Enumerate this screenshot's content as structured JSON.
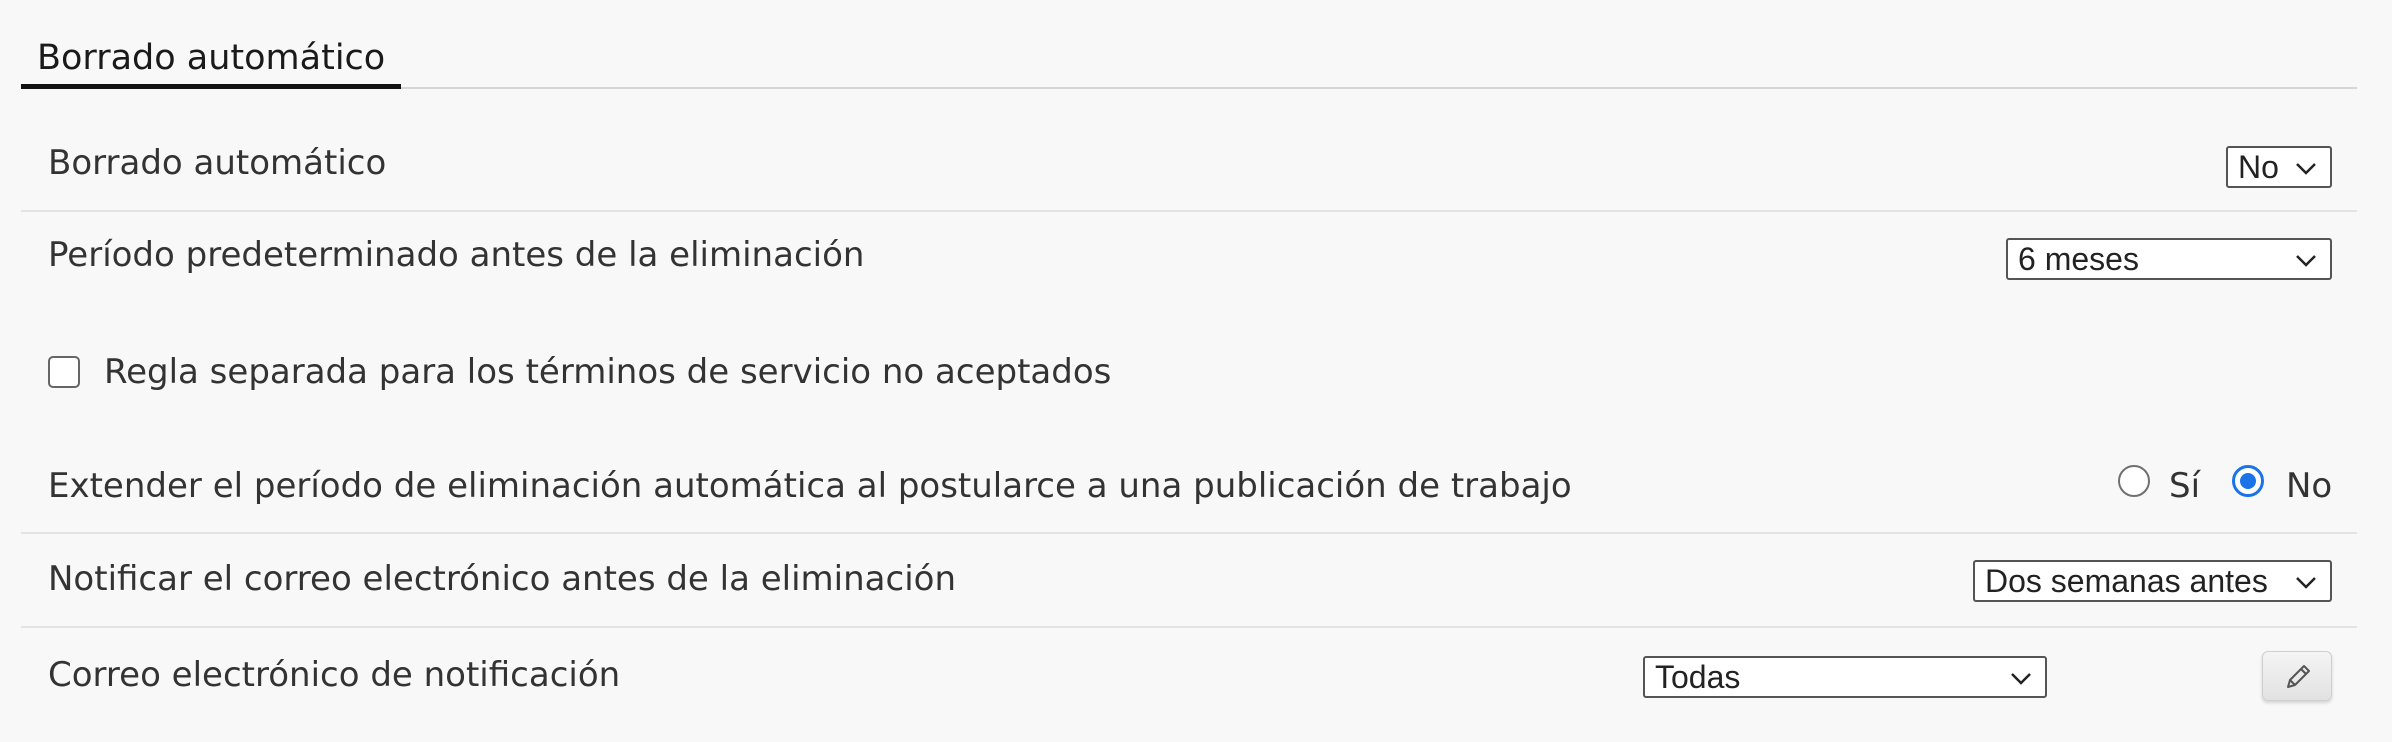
{
  "tab": {
    "label": "Borrado automático"
  },
  "settings": {
    "auto_delete": {
      "label": "Borrado automático",
      "value": "No"
    },
    "default_period": {
      "label": "Período predeterminado antes de la eliminación",
      "value": "6 meses"
    },
    "separate_rule": {
      "label": "Regla separada para los términos de servicio no aceptados",
      "checked": false
    },
    "extend_period": {
      "label": "Extender el período de eliminación automática al postularce a una publicación de trabajo",
      "options": [
        "Sí",
        "No"
      ],
      "selected": "No"
    },
    "notify_email": {
      "label": "Notificar el correo electrónico antes de la eliminación",
      "value": "Dos semanas antes"
    },
    "notification_email": {
      "label": "Correo electrónico de notificación",
      "value": "Todas",
      "edit_icon": "pencil-icon"
    }
  },
  "colors": {
    "accent": "#1a73e8",
    "text": "#333333",
    "background": "#f8f8f8"
  }
}
